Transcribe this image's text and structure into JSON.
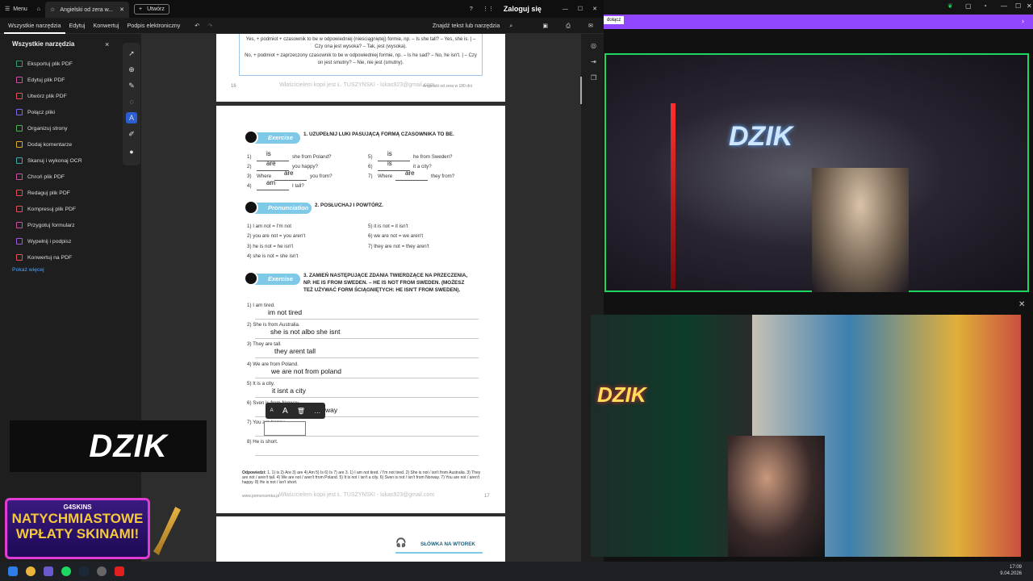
{
  "window": {
    "menu_label": "Menu",
    "tab_title": "Angielski od zera w...",
    "new_tab": "Utwórz",
    "login": "Zaloguj się"
  },
  "menubar": {
    "items": [
      "Wszystkie narzędzia",
      "Edytuj",
      "Konwertuj",
      "Podpis elektroniczny"
    ],
    "search": "Znajdź tekst lub narzędzia"
  },
  "tools_panel": {
    "title": "Wszystkie narzędzia",
    "items": [
      "Eksportuj plik PDF",
      "Edytuj plik PDF",
      "Utwórz plik PDF",
      "Połącz pliki",
      "Organizuj strony",
      "Dodaj komentarze",
      "Skanuj i wykonaj OCR",
      "Chroń plik PDF",
      "Redaguj plik PDF",
      "Kompresuj plik PDF",
      "Przygotuj formularz",
      "Wypełnij i podpisz",
      "Konwertuj na PDF"
    ],
    "colors": [
      "#2f9e6b",
      "#c94fa0",
      "#e04e5a",
      "#7a66e6",
      "#4caf50",
      "#e0a82e",
      "#3ba7ae",
      "#c94fa0",
      "#e04e5a",
      "#e04e5a",
      "#c94fa0",
      "#9b59d9",
      "#e04e5a"
    ],
    "show_more": "Pokaż więcej"
  },
  "page1": {
    "rule_yes": "Yes, + podmiot + czasownik to be w odpowiedniej (nieściągniętej) formie, np. – Is she tall? – Yes, she is. | – Czy ona jest wysoka? – Tak, jest (wysoka).",
    "rule_no": "No, + podmiot + zaprzeczony czasownik to be w odpowiedniej formie, np. – Is he sad? – No, he isn't. | – Czy on jest smutny? – Nie, nie jest (smutny).",
    "page_no": "16",
    "watermark": "Właścicielem kopii jest Ł. TUSZYNSKI - lukas923@gmail.com",
    "footer": "Angielski od zera w 180 dni"
  },
  "ex1": {
    "tag": "Exercise",
    "title": "1.   UZUPEŁNIJ LUKI PASUJĄCĄ FORMĄ CZASOWNIKA TO BE.",
    "items": [
      {
        "n": "1)",
        "after": "she from Poland?",
        "ans": "is"
      },
      {
        "n": "2)",
        "after": "you happy?",
        "ans": "are"
      },
      {
        "n": "3)",
        "before": "Where",
        "after": "you from?",
        "ans": "are"
      },
      {
        "n": "4)",
        "after": "I tall?",
        "ans": "am"
      },
      {
        "n": "5)",
        "after": "he from Sweden?",
        "ans": "is"
      },
      {
        "n": "6)",
        "after": "it a city?",
        "ans": "is"
      },
      {
        "n": "7)",
        "before": "Where",
        "after": "they from?",
        "ans": "are"
      }
    ]
  },
  "ex2": {
    "tag": "Pronunciation",
    "title": "2.   POSŁUCHAJ I POWTÓRZ.",
    "items": [
      "1)   I am not = I'm not",
      "2)   you are not = you aren't",
      "3)   he is not = he isn't",
      "4)   she is not = she isn't",
      "5)   it is not = it isn't",
      "6)   we are not = we aren't",
      "7)   they are not = they aren't"
    ]
  },
  "ex3": {
    "tag": "Exercise",
    "title1": "3.   ZAMIEŃ NASTĘPUJĄCE ZDANIA TWIERDZĄCE NA PRZECZENIA,",
    "title2": "NP. HE IS FROM SWEDEN. – HE IS NOT FROM SWEDEN. (MOŻESZ",
    "title3": "TEŻ UŻYWAĆ FORM ŚCIĄGNIĘTYCH: HE ISN'T FROM SWEDEN).",
    "items": [
      {
        "q": "1)   I am tired.",
        "a": "im not tired"
      },
      {
        "q": "2)   She is from Australia.",
        "a": "she is not albo she isnt"
      },
      {
        "q": "3)   They are tall.",
        "a": "they arent tall"
      },
      {
        "q": "4)   We are from Poland.",
        "a": "we are not from poland"
      },
      {
        "q": "5)   It is a city.",
        "a": "it isnt a city"
      },
      {
        "q": "6)   Sven is from Norway.",
        "a": "way"
      },
      {
        "q": "7)   You are happy.",
        "a": "you are no"
      },
      {
        "q": "8)   He is short.",
        "a": ""
      }
    ]
  },
  "answers": {
    "label": "Odpowiedzi:",
    "text": "1. 1) is 2) Are 3) are 4) Am 5) Is 6) Is 7) are 3. 1) I am not tired. / I'm not tired. 2) She is not / isn't from Australia. 3) They are not / aren't tall. 4) We are not / aren't from Poland. 5) It is not / isn't a city. 6) Sven is not / isn't from Norway. 7) You are not / aren't happy. 8) He is not / isn't short."
  },
  "page2_footer": {
    "left": "www.pomorsomka.pl",
    "watermark": "Właścicielem kopii jest Ł. TUSZYNSKI - lukas923@gmail.com",
    "page_no": "17"
  },
  "page3": {
    "heading": "SŁÓWKA NA WTOREK"
  },
  "overlay": {
    "dzik": "DZIK",
    "promo_brand": "G4SKINS",
    "promo_line1": "NATYCHMIASTOWE",
    "promo_line2": "WPŁATY SKINAMI!",
    "cam1_neon": "DZIK",
    "cam2_neon": "DZIK",
    "join_button": "dołącz"
  },
  "clock": {
    "time": "17:09",
    "date": "9.04.2026"
  }
}
